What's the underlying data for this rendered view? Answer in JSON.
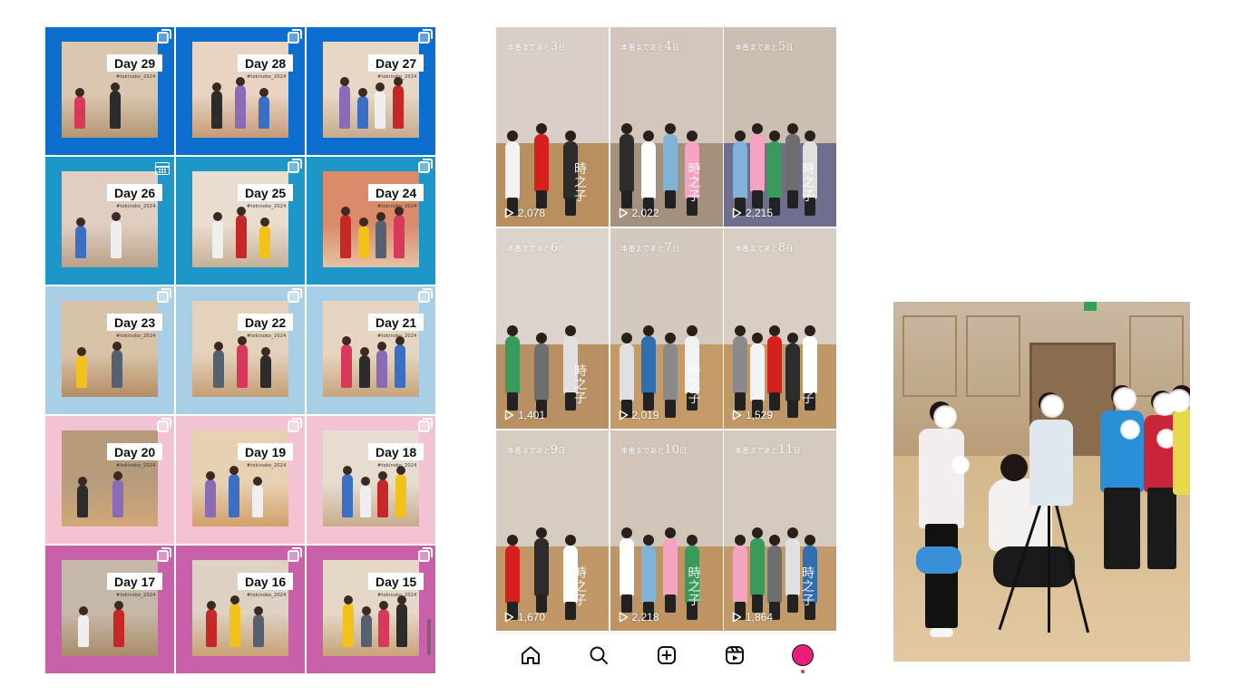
{
  "left_grid": {
    "hashtag": "#tokinoko_2024",
    "posts": [
      {
        "day": "Day 29",
        "bg": "#0c6fcf",
        "icon": "multi-post-icon"
      },
      {
        "day": "Day 28",
        "bg": "#0c6fcf",
        "icon": "multi-post-icon"
      },
      {
        "day": "Day 27",
        "bg": "#0c6fcf",
        "icon": "multi-post-icon"
      },
      {
        "day": "Day 26",
        "bg": "#1c97c8",
        "icon": "calendar-icon"
      },
      {
        "day": "Day 25",
        "bg": "#1c97c8",
        "icon": "multi-post-icon"
      },
      {
        "day": "Day 24",
        "bg": "#1c97c8",
        "icon": "multi-post-icon"
      },
      {
        "day": "Day 23",
        "bg": "#a9cfe6",
        "icon": "multi-post-icon"
      },
      {
        "day": "Day 22",
        "bg": "#a9cfe6",
        "icon": "multi-post-icon"
      },
      {
        "day": "Day 21",
        "bg": "#a9cfe6",
        "icon": "multi-post-icon"
      },
      {
        "day": "Day 20",
        "bg": "#f3c3d3",
        "icon": "multi-post-icon"
      },
      {
        "day": "Day 19",
        "bg": "#f3c3d3",
        "icon": "multi-post-icon"
      },
      {
        "day": "Day 18",
        "bg": "#f3c3d3",
        "icon": "multi-post-icon"
      },
      {
        "day": "Day 17",
        "bg": "#c861aa",
        "icon": "multi-post-icon"
      },
      {
        "day": "Day 16",
        "bg": "#c861aa",
        "icon": "multi-post-icon"
      },
      {
        "day": "Day 15",
        "bg": "#c861aa",
        "icon": "multi-post-icon"
      }
    ]
  },
  "reels": {
    "items": [
      {
        "prefix": "本番まであと",
        "num": "3",
        "suffix": "日",
        "views": "2,078"
      },
      {
        "prefix": "本番まであと",
        "num": "4",
        "suffix": "日",
        "views": "2,022"
      },
      {
        "prefix": "本番まであと",
        "num": "5",
        "suffix": "日",
        "views": "2,215"
      },
      {
        "prefix": "本番まであと",
        "num": "6",
        "suffix": "日",
        "views": "1,401"
      },
      {
        "prefix": "本番まであと",
        "num": "7",
        "suffix": "日",
        "views": "2,019"
      },
      {
        "prefix": "本番まであと",
        "num": "8",
        "suffix": "日",
        "views": "1,529"
      },
      {
        "prefix": "本番まであと",
        "num": "9",
        "suffix": "日",
        "views": "1,670"
      },
      {
        "prefix": "本番まであと",
        "num": "10",
        "suffix": "日",
        "views": "2,218"
      },
      {
        "prefix": "本番まであと",
        "num": "11",
        "suffix": "日",
        "views": "1,864"
      }
    ],
    "logo_text": "時之子"
  },
  "navbar": {
    "items": [
      "home-icon",
      "search-icon",
      "create-icon",
      "reels-icon",
      "profile-avatar"
    ],
    "avatar_color": "#e91e7a",
    "notification_color": "#ed2e5b"
  }
}
